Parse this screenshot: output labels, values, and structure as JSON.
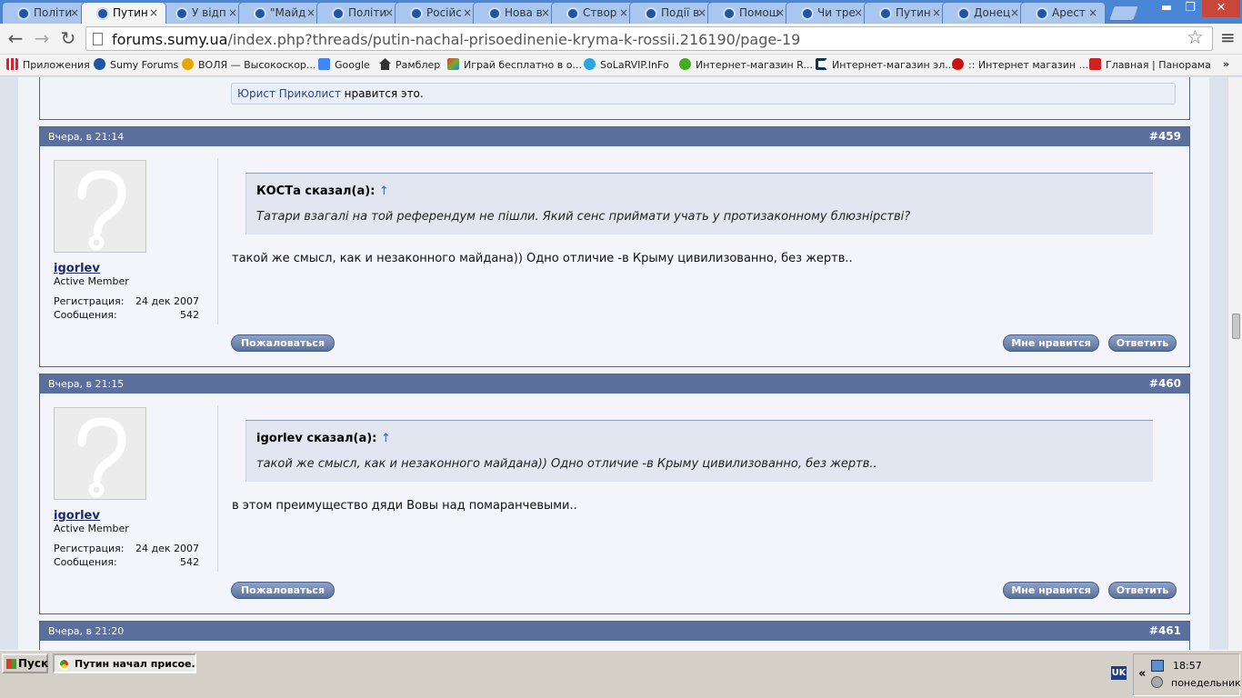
{
  "browser": {
    "tabs": [
      {
        "label": "Політи",
        "active": false
      },
      {
        "label": "Путин",
        "active": true
      },
      {
        "label": "У відп",
        "active": false
      },
      {
        "label": "\"Майд",
        "active": false
      },
      {
        "label": "Політи",
        "active": false
      },
      {
        "label": "Російс",
        "active": false
      },
      {
        "label": "Нова в",
        "active": false
      },
      {
        "label": "Створ",
        "active": false
      },
      {
        "label": "Події в",
        "active": false
      },
      {
        "label": "Помош",
        "active": false
      },
      {
        "label": "Чи тре",
        "active": false
      },
      {
        "label": "Путин",
        "active": false
      },
      {
        "label": "Донец",
        "active": false
      },
      {
        "label": "Арест",
        "active": false
      }
    ],
    "close_glyph": "×",
    "window_controls": {
      "minimize": "▬",
      "maximize": "❐",
      "close": "✕"
    },
    "nav": {
      "back": "←",
      "forward": "→",
      "reload": "↻"
    },
    "url_host": "forums.sumy.ua",
    "url_path": "/index.php?threads/putin-nachal-prisoedinenie-kryma-k-rossii.216190/page-19",
    "star": "☆",
    "menu": "≡",
    "bookmarks": [
      {
        "label": "Приложения",
        "icon": "apps-grid-icon",
        "color": "#d23"
      },
      {
        "label": "Sumy Forums",
        "icon": "sumy-forums-icon",
        "color": "#1f56a3"
      },
      {
        "label": "ВОЛЯ — Высокоскор...",
        "icon": "volia-icon",
        "color": "#e6a700"
      },
      {
        "label": "Google",
        "icon": "google-icon",
        "color": "#4285f4"
      },
      {
        "label": "Рамблер",
        "icon": "house-icon",
        "color": "#333"
      },
      {
        "label": "Играй бесплатно в о...",
        "icon": "game-cube-icon",
        "color": "#7a3"
      },
      {
        "label": "SoLaRVIP.InFo",
        "icon": "solarvip-icon",
        "color": "#29a6e0"
      },
      {
        "label": "Интернет-магазин R...",
        "icon": "frog-icon",
        "color": "#4a2"
      },
      {
        "label": "Интернет-магазин эл...",
        "icon": "shop-c-icon",
        "color": "#135"
      },
      {
        "label": ":: Интернет магазин ...",
        "icon": "shop-red-icon",
        "color": "#c11"
      },
      {
        "label": "Главная | Панорама",
        "icon": "panorama-p-icon",
        "color": "#c22"
      }
    ],
    "bookmarks_more": "»"
  },
  "forum": {
    "like_user": "Юрист Приколист",
    "like_text": " нравится это.",
    "posts": [
      {
        "time": "Вчера, в 21:14",
        "number": "#459",
        "username": "igorlev",
        "rank": "Active Member",
        "reg_label": "Регистрация:",
        "reg_value": "24 дек 2007",
        "msgs_label": "Сообщения:",
        "msgs_value": "542",
        "quote_author": "КОСТа сказал(а):",
        "quote_arrow": "↑",
        "quote_text": "Татари взагалі на той референдум не пішли. Який сенс приймати учать у протизаконному блюзнірстві?",
        "message": "такой же смысл, как и незаконного майдана)) Одно отличие -в Крыму цивилизованно, без жертв..",
        "report": "Пожаловаться",
        "like": "Мне нравится",
        "reply": "Ответить"
      },
      {
        "time": "Вчера, в 21:15",
        "number": "#460",
        "username": "igorlev",
        "rank": "Active Member",
        "reg_label": "Регистрация:",
        "reg_value": "24 дек 2007",
        "msgs_label": "Сообщения:",
        "msgs_value": "542",
        "quote_author": "igorlev сказал(а):",
        "quote_arrow": "↑",
        "quote_text": "такой же смысл, как и незаконного майдана)) Одно отличие -в Крыму цивилизованно, без жертв..",
        "message": "в этом преимущество дяди Вовы над помаранчевыми..",
        "report": "Пожаловаться",
        "like": "Мне нравится",
        "reply": "Ответить"
      },
      {
        "time": "Вчера, в 21:20",
        "number": "#461"
      }
    ]
  },
  "taskbar": {
    "start": "Пуск",
    "window_title": "Путин начал присое...",
    "lang": "UK",
    "tray_chevron": "«",
    "time": "18:57",
    "day": "понедельник"
  }
}
